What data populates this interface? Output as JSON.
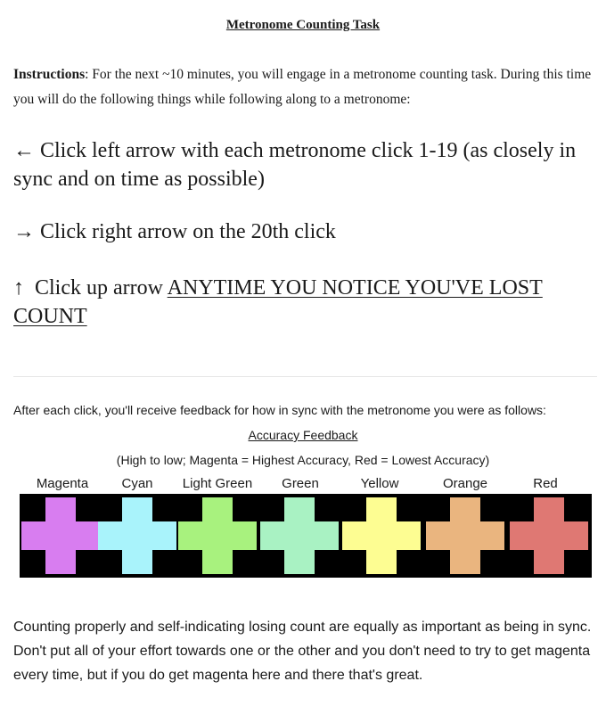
{
  "title": "Metronome Counting Task",
  "instructions": {
    "label": "Instructions",
    "text": ": For the next ~10 minutes, you will engage in a metronome counting task. During this time you will do the following things while following along to a metronome:"
  },
  "steps": {
    "left": {
      "arrow": "←",
      "text": " Click left arrow with each metronome click 1-19 (as closely in sync and on time as possible)"
    },
    "right": {
      "arrow": "→",
      "text": " Click right arrow on the 20th click"
    },
    "up": {
      "arrow": "↑",
      "text": "  Click up arrow ",
      "emphasis": "ANYTIME YOU NOTICE YOU'VE LOST COUNT"
    }
  },
  "feedback": {
    "intro": "After each click, you'll receive feedback for how in sync with the metronome you were as follows:",
    "heading": "Accuracy Feedback",
    "range": "(High to low; Magenta = Highest Accuracy, Red = Lowest Accuracy)",
    "colors": [
      {
        "name": "Magenta",
        "hex": "#d87df0"
      },
      {
        "name": "Cyan",
        "hex": "#a9f3fb"
      },
      {
        "name": "Light Green",
        "hex": "#a8f27e"
      },
      {
        "name": "Green",
        "hex": "#a9f2c3"
      },
      {
        "name": "Yellow",
        "hex": "#fdfd92"
      },
      {
        "name": "Orange",
        "hex": "#eab57f"
      },
      {
        "name": "Red",
        "hex": "#df7873"
      }
    ]
  },
  "closing": "Counting properly and self-indicating losing count are equally as important as being in sync. Don't put all of your effort towards one or the other and you don't need to try to get magenta every time, but if you do get magenta here and there that's great."
}
